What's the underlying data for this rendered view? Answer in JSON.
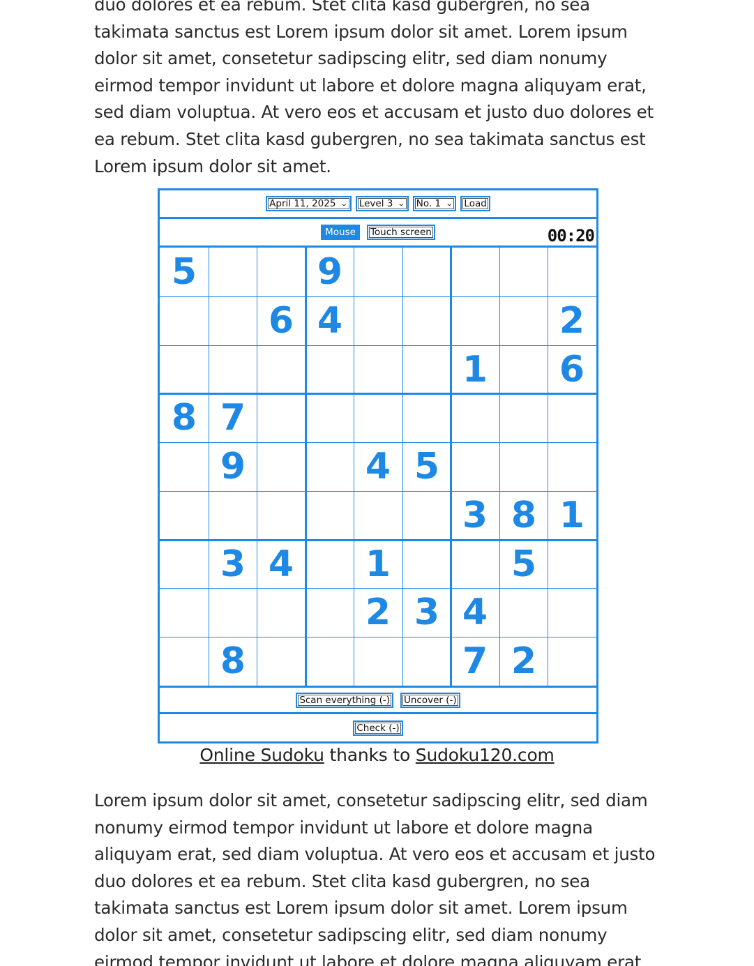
{
  "top_paragraph_lines": [
    "duo dolores et ea rebum. Stet clita kasd gubergren, no sea",
    "takimata sanctus est Lorem ipsum dolor sit amet. Lorem ipsum",
    "dolor sit amet, consetetur sadipscing elitr, sed diam nonumy",
    "eirmod tempor invidunt ut labore et dolore magna aliquyam erat,",
    "sed diam voluptua. At vero eos et accusam et justo duo dolores et",
    "ea rebum. Stet clita kasd gubergren, no sea takimata sanctus est",
    "Lorem ipsum dolor sit amet."
  ],
  "controls": {
    "date_select": "April 11, 2025",
    "level_select": "Level 3",
    "number_select": "No. 1",
    "load_button": "Load",
    "mode_mouse": "Mouse",
    "mode_touch": "Touch screen",
    "active_mode": "Mouse",
    "timer": "00:20",
    "scan_button": "Scan everything (-)",
    "uncover_button": "Uncover (-)",
    "check_button": "Check (-)"
  },
  "grid": [
    [
      "5",
      "",
      "",
      "9",
      "",
      "",
      "",
      "",
      ""
    ],
    [
      "",
      "",
      "6",
      "4",
      "",
      "",
      "",
      "",
      "2"
    ],
    [
      "",
      "",
      "",
      "",
      "",
      "",
      "1",
      "",
      "6"
    ],
    [
      "8",
      "7",
      "",
      "",
      "",
      "",
      "",
      "",
      ""
    ],
    [
      "",
      "9",
      "",
      "",
      "4",
      "5",
      "",
      "",
      ""
    ],
    [
      "",
      "",
      "",
      "",
      "",
      "",
      "3",
      "8",
      "1"
    ],
    [
      "",
      "3",
      "4",
      "",
      "1",
      "",
      "",
      "5",
      ""
    ],
    [
      "",
      "",
      "",
      "",
      "2",
      "3",
      "4",
      "",
      ""
    ],
    [
      "",
      "8",
      "",
      "",
      "",
      "",
      "7",
      "2",
      ""
    ]
  ],
  "caption": {
    "link1": "Online Sudoku",
    "middle": " thanks to ",
    "link2": "Sudoku120.com"
  },
  "bottom_paragraph_lines": [
    "Lorem ipsum dolor sit amet, consetetur sadipscing elitr, sed diam",
    "nonumy eirmod tempor invidunt ut labore et dolore magna",
    "aliquyam erat, sed diam voluptua. At vero eos et accusam et justo",
    "duo dolores et ea rebum. Stet clita kasd gubergren, no sea",
    "takimata sanctus est Lorem ipsum dolor sit amet. Lorem ipsum",
    "dolor sit amet, consetetur sadipscing elitr, sed diam nonumy",
    "eirmod tempor invidunt ut labore et dolore magna aliquyam erat,"
  ],
  "colors": {
    "accent": "#1e88e5",
    "text": "#2a2a2a"
  }
}
